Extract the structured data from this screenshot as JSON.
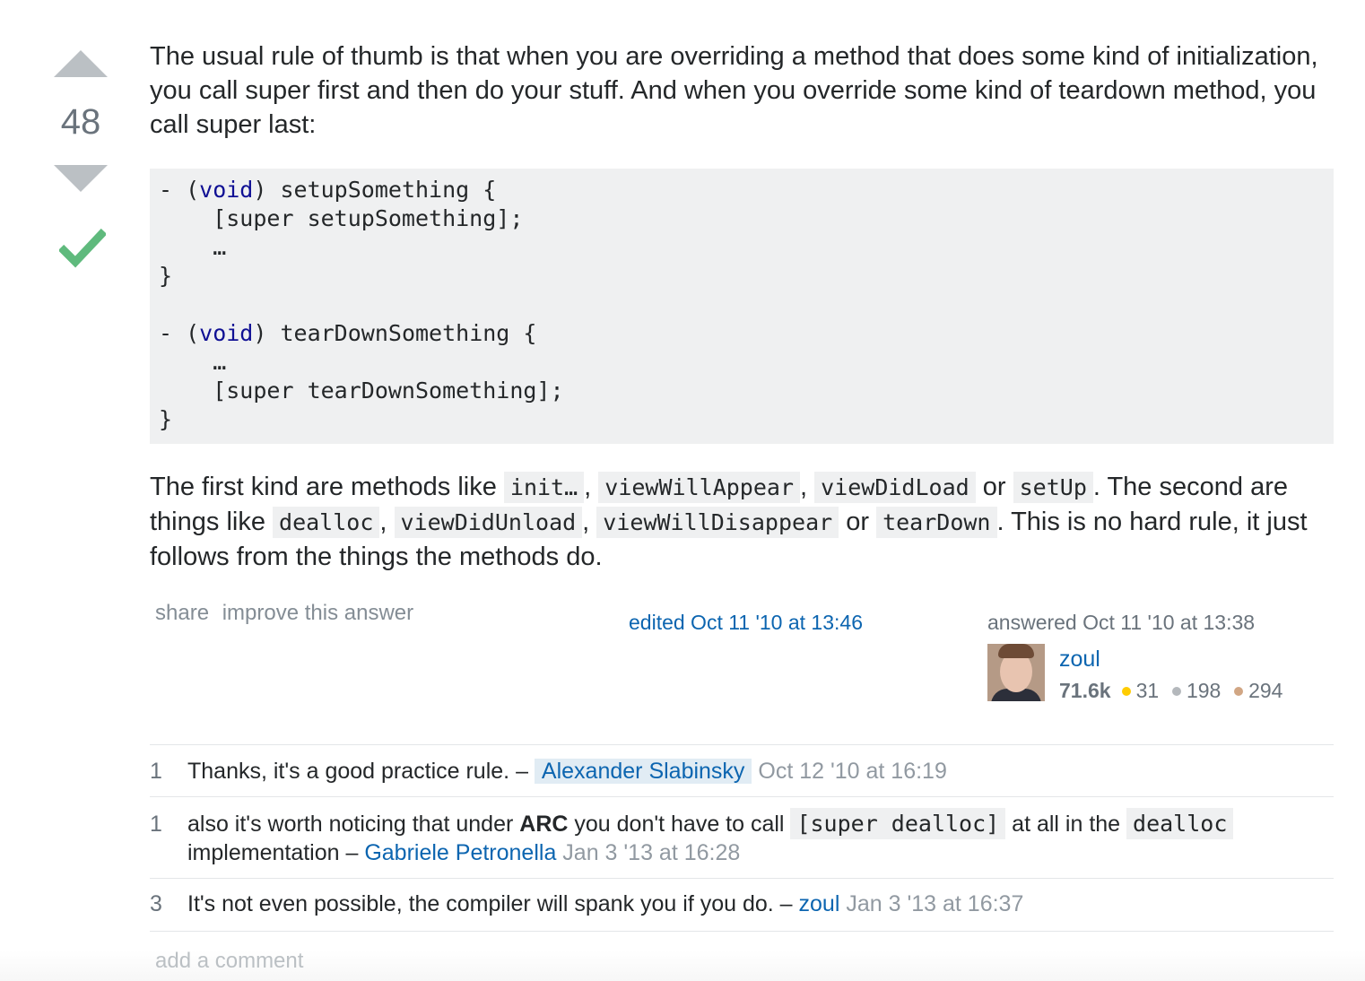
{
  "vote": {
    "count": "48"
  },
  "post": {
    "intro": "The usual rule of thumb is that when you are overriding a method that does some kind of initialization, you call super first and then do your stuff. And when you override some kind of teardown method, you call super last:",
    "code": {
      "line1_prefix": "- (",
      "line1_kw": "void",
      "line1_suffix": ") setupSomething {",
      "line2": "    [super setupSomething];",
      "line3": "    …",
      "line4": "}",
      "line6_prefix": "- (",
      "line6_kw": "void",
      "line6_suffix": ") tearDownSomething {",
      "line7": "    …",
      "line8": "    [super tearDownSomething];",
      "line9": "}"
    },
    "para2": {
      "t1": "The first kind are methods like ",
      "c1": "init…",
      "t2": ", ",
      "c2": "viewWillAppear",
      "t3": ", ",
      "c3": "viewDidLoad",
      "t4": " or ",
      "c4": "setUp",
      "t5": ". The second are things like ",
      "c5": "dealloc",
      "t6": ", ",
      "c6": "viewDidUnload",
      "t7": ", ",
      "c7": "viewWillDisappear",
      "t8": " or ",
      "c8": "tearDown",
      "t9": ". This is no hard rule, it just follows from the things the methods do."
    }
  },
  "menu": {
    "share": "share",
    "improve": "improve this answer"
  },
  "edited": "edited Oct 11 '10 at 13:46",
  "answered": "answered Oct 11 '10 at 13:38",
  "user": {
    "name": "zoul",
    "rep": "71.6k",
    "gold": "31",
    "silver": "198",
    "bronze": "294"
  },
  "comments": [
    {
      "score": "1",
      "text": "Thanks, it's a good practice rule. – ",
      "user": "Alexander Slabinsky",
      "date": "Oct 12 '10 at 16:19"
    },
    {
      "score": "1",
      "t1": "also it's worth noticing that under ",
      "bold": "ARC",
      "t2": " you don't have to call ",
      "code1": "[super dealloc]",
      "t3": " at all in the ",
      "code2": "dealloc",
      "t4": " implementation – ",
      "user": "Gabriele Petronella",
      "date": "Jan 3 '13 at 16:28"
    },
    {
      "score": "3",
      "text": "It's not even possible, the compiler will spank you if you do. – ",
      "user": "zoul",
      "date": "Jan 3 '13 at 16:37"
    }
  ],
  "add_comment": "add a comment",
  "colors": {
    "link": "#0c65b0",
    "accept": "#5fba7d",
    "vote_arrow": "#bbc0c4",
    "code_bg": "#eff0f1"
  }
}
